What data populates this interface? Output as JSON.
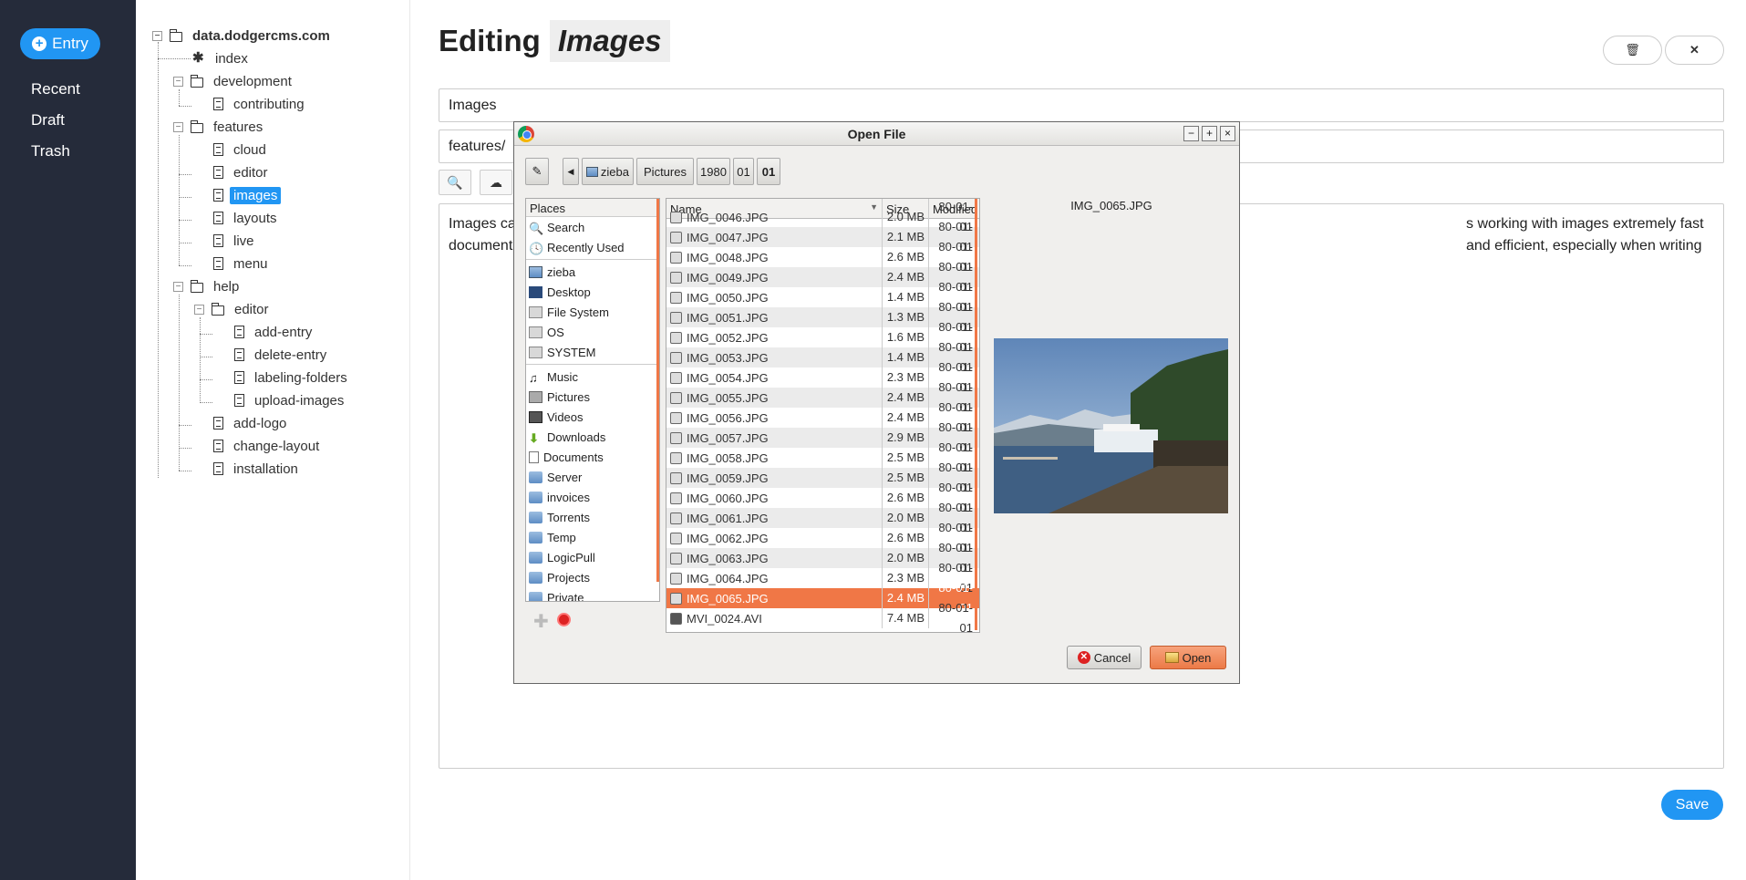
{
  "nav": {
    "new_entry_label": "Entry",
    "links": [
      "Recent",
      "Draft",
      "Trash"
    ]
  },
  "tree": {
    "root": "data.dodgercms.com",
    "nodes": [
      {
        "label": "index",
        "type": "special"
      },
      {
        "label": "development",
        "type": "folder"
      },
      {
        "label": "contributing",
        "type": "file"
      },
      {
        "label": "features",
        "type": "folder"
      },
      {
        "label": "cloud",
        "type": "file"
      },
      {
        "label": "editor",
        "type": "file"
      },
      {
        "label": "images",
        "type": "file",
        "selected": true
      },
      {
        "label": "layouts",
        "type": "file"
      },
      {
        "label": "live",
        "type": "file"
      },
      {
        "label": "menu",
        "type": "file"
      },
      {
        "label": "help",
        "type": "folder"
      },
      {
        "label": "editor",
        "type": "folder"
      },
      {
        "label": "add-entry",
        "type": "file"
      },
      {
        "label": "delete-entry",
        "type": "file"
      },
      {
        "label": "labeling-folders",
        "type": "file"
      },
      {
        "label": "upload-images",
        "type": "file"
      },
      {
        "label": "add-logo",
        "type": "file"
      },
      {
        "label": "change-layout",
        "type": "file"
      },
      {
        "label": "installation",
        "type": "file"
      }
    ]
  },
  "main": {
    "title_prefix": "Editing",
    "title_name": "Images",
    "title_field": "Images",
    "path_field": "features/",
    "editor_text_left": "Images ca",
    "editor_text_left2": "document",
    "editor_text_right": "s working with images extremely fast and efficient, especially when writing",
    "save_label": "Save",
    "delete_icon": "trash-icon",
    "close_icon": "close-icon"
  },
  "dialog": {
    "title": "Open File",
    "path": [
      "zieba",
      "Pictures",
      "1980",
      "01",
      "01"
    ],
    "places_header": "Places",
    "places": [
      {
        "label": "Search",
        "icon": "search"
      },
      {
        "label": "Recently Used",
        "icon": "clock"
      },
      {
        "sep": true
      },
      {
        "label": "zieba",
        "icon": "home"
      },
      {
        "label": "Desktop",
        "icon": "desktop"
      },
      {
        "label": "File System",
        "icon": "drive"
      },
      {
        "label": "OS",
        "icon": "drive"
      },
      {
        "label": "SYSTEM",
        "icon": "drive"
      },
      {
        "sep": true
      },
      {
        "label": "Music",
        "icon": "music"
      },
      {
        "label": "Pictures",
        "icon": "pictures"
      },
      {
        "label": "Videos",
        "icon": "videos"
      },
      {
        "label": "Downloads",
        "icon": "downloads"
      },
      {
        "label": "Documents",
        "icon": "documents"
      },
      {
        "label": "Server",
        "icon": "folder"
      },
      {
        "label": "invoices",
        "icon": "folder"
      },
      {
        "label": "Torrents",
        "icon": "folder"
      },
      {
        "label": "Temp",
        "icon": "folder"
      },
      {
        "label": "LogicPull",
        "icon": "folder"
      },
      {
        "label": "Projects",
        "icon": "folder"
      },
      {
        "label": "Private",
        "icon": "folder"
      }
    ],
    "columns": {
      "name": "Name",
      "size": "Size",
      "modified": "Modified"
    },
    "files": [
      {
        "name": "IMG_0047.JPG",
        "size": "2.1 MB",
        "modified": "80-01-01"
      },
      {
        "name": "IMG_0048.JPG",
        "size": "2.6 MB",
        "modified": "80-01-01"
      },
      {
        "name": "IMG_0049.JPG",
        "size": "2.4 MB",
        "modified": "80-01-01"
      },
      {
        "name": "IMG_0050.JPG",
        "size": "1.4 MB",
        "modified": "80-01-01"
      },
      {
        "name": "IMG_0051.JPG",
        "size": "1.3 MB",
        "modified": "80-01-01"
      },
      {
        "name": "IMG_0052.JPG",
        "size": "1.6 MB",
        "modified": "80-01-01"
      },
      {
        "name": "IMG_0053.JPG",
        "size": "1.4 MB",
        "modified": "80-01-01"
      },
      {
        "name": "IMG_0054.JPG",
        "size": "2.3 MB",
        "modified": "80-01-01"
      },
      {
        "name": "IMG_0055.JPG",
        "size": "2.4 MB",
        "modified": "80-01-01"
      },
      {
        "name": "IMG_0056.JPG",
        "size": "2.4 MB",
        "modified": "80-01-01"
      },
      {
        "name": "IMG_0057.JPG",
        "size": "2.9 MB",
        "modified": "80-01-01"
      },
      {
        "name": "IMG_0058.JPG",
        "size": "2.5 MB",
        "modified": "80-01-01"
      },
      {
        "name": "IMG_0059.JPG",
        "size": "2.5 MB",
        "modified": "80-01-01"
      },
      {
        "name": "IMG_0060.JPG",
        "size": "2.6 MB",
        "modified": "80-01-01"
      },
      {
        "name": "IMG_0061.JPG",
        "size": "2.0 MB",
        "modified": "80-01-01"
      },
      {
        "name": "IMG_0062.JPG",
        "size": "2.6 MB",
        "modified": "80-01-01"
      },
      {
        "name": "IMG_0063.JPG",
        "size": "2.0 MB",
        "modified": "80-01-01"
      },
      {
        "name": "IMG_0064.JPG",
        "size": "2.3 MB",
        "modified": "80-01-01"
      },
      {
        "name": "IMG_0065.JPG",
        "size": "2.4 MB",
        "modified": "80-01-01",
        "selected": true
      },
      {
        "name": "MVI_0024.AVI",
        "size": "7.4 MB",
        "modified": "80-01-01"
      }
    ],
    "preview_name": "IMG_0065.JPG",
    "cancel_label": "Cancel",
    "open_label": "Open",
    "accent_color": "#f07746"
  }
}
